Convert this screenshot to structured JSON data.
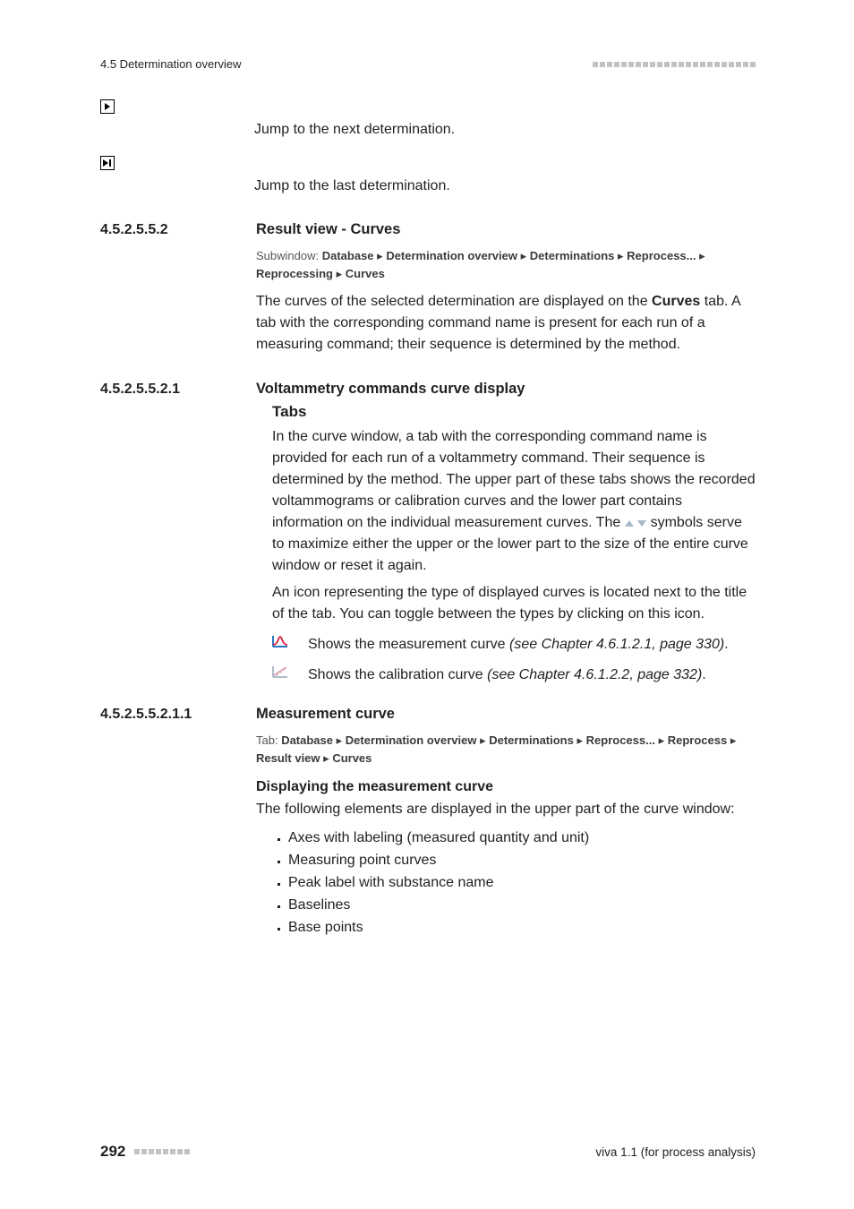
{
  "header": {
    "section_label": "4.5 Determination overview"
  },
  "nav_icons": {
    "next": {
      "description": "Jump to the next determination."
    },
    "last": {
      "description": "Jump to the last determination."
    }
  },
  "sec1": {
    "number": "4.5.2.5.5.2",
    "title": "Result view - Curves",
    "breadcrumb_prefix": "Subwindow: ",
    "breadcrumb": [
      "Database",
      "Determination overview",
      "Determinations",
      "Reprocess...",
      "Reprocessing",
      "Curves"
    ],
    "para_before_bold": "The curves of the selected determination are displayed on the ",
    "para_bold": "Curves",
    "para_after_bold": " tab. A tab with the corresponding command name is present for each run of a measuring command; their sequence is determined by the method."
  },
  "sec2": {
    "number": "4.5.2.5.5.2.1",
    "title": "Voltammetry commands curve display",
    "sub": "Tabs",
    "p1_a": "In the curve window, a tab with the corresponding command name is provided for each run of a voltammetry command. Their sequence is determined by the method. The upper part of these tabs shows the recorded voltammograms or calibration curves and the lower part contains information on the individual measurement curves. The ",
    "p1_b": " symbols serve to maximize either the upper or the lower part to the size of the entire curve window or reset it again.",
    "p2": "An icon representing the type of displayed curves is located next to the title of the tab. You can toggle between the types by clicking on this icon.",
    "ic1_a": "Shows the measurement curve ",
    "ic1_ref": "(see Chapter 4.6.1.2.1, page 330)",
    "ic1_b": ".",
    "ic2_a": "Shows the calibration curve ",
    "ic2_ref": "(see Chapter 4.6.1.2.2, page 332)",
    "ic2_b": "."
  },
  "sec3": {
    "number": "4.5.2.5.5.2.1.1",
    "title": "Measurement curve",
    "breadcrumb_prefix": "Tab: ",
    "breadcrumb": [
      "Database",
      "Determination overview",
      "Determinations",
      "Reprocess...",
      "Reprocess",
      "Result view",
      "Curves"
    ],
    "sub": "Displaying the measurement curve",
    "p": "The following elements are displayed in the upper part of the curve window:",
    "bullets": [
      "Axes with labeling (measured quantity and unit)",
      "Measuring point curves",
      "Peak label with substance name",
      "Baselines",
      "Base points"
    ]
  },
  "footer": {
    "page": "292",
    "product": "viva 1.1 (for process analysis)"
  }
}
